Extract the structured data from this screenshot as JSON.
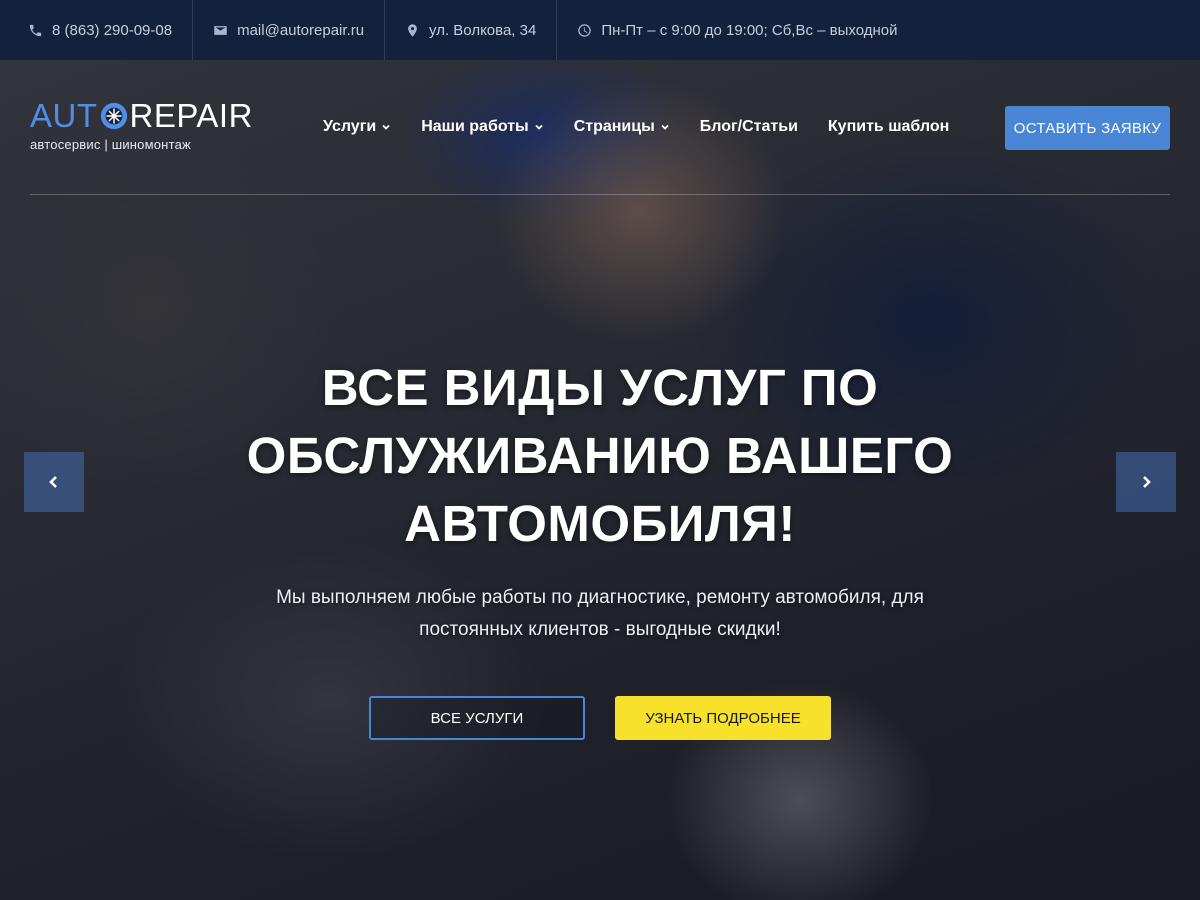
{
  "topbar": {
    "phone": "8 (863) 290-09-08",
    "email": "mail@autorepair.ru",
    "address": "ул. Волкова, 34",
    "hours": "Пн-Пт – с 9:00 до 19:00; Сб,Вс – выходной"
  },
  "logo": {
    "word_left": "AUT",
    "word_right": "REPAIR",
    "tagline": "автосервис | шиномонтаж"
  },
  "nav": {
    "items": [
      {
        "label": "Услуги",
        "has_dropdown": true
      },
      {
        "label": "Наши работы",
        "has_dropdown": true
      },
      {
        "label": "Страницы",
        "has_dropdown": true
      },
      {
        "label": "Блог/Статьи",
        "has_dropdown": false
      },
      {
        "label": "Купить шаблон",
        "has_dropdown": false
      }
    ],
    "cta_label": "ОСТАВИТЬ ЗАЯВКУ"
  },
  "hero": {
    "headline": "ВСЕ ВИДЫ УСЛУГ ПО ОБСЛУЖИВАНИЮ ВАШЕГО АВТОМОБИЛЯ!",
    "subtext": "Мы выполняем любые работы по диагностике, ремонту автомобиля, для постоянных клиентов - выгодные скидки!",
    "btn_primary": "ВСЕ УСЛУГИ",
    "btn_secondary": "УЗНАТЬ ПОДРОБНЕЕ"
  },
  "icons": {
    "phone": "phone-icon",
    "email": "envelope-icon",
    "address": "map-pin-icon",
    "hours": "clock-icon",
    "prev": "chevron-left-icon",
    "next": "chevron-right-icon"
  },
  "colors": {
    "topbar_bg": "#13213d",
    "accent_blue": "#4a86d6",
    "logo_blue": "#4f8fe6",
    "yellow_button": "#f7e12b"
  }
}
